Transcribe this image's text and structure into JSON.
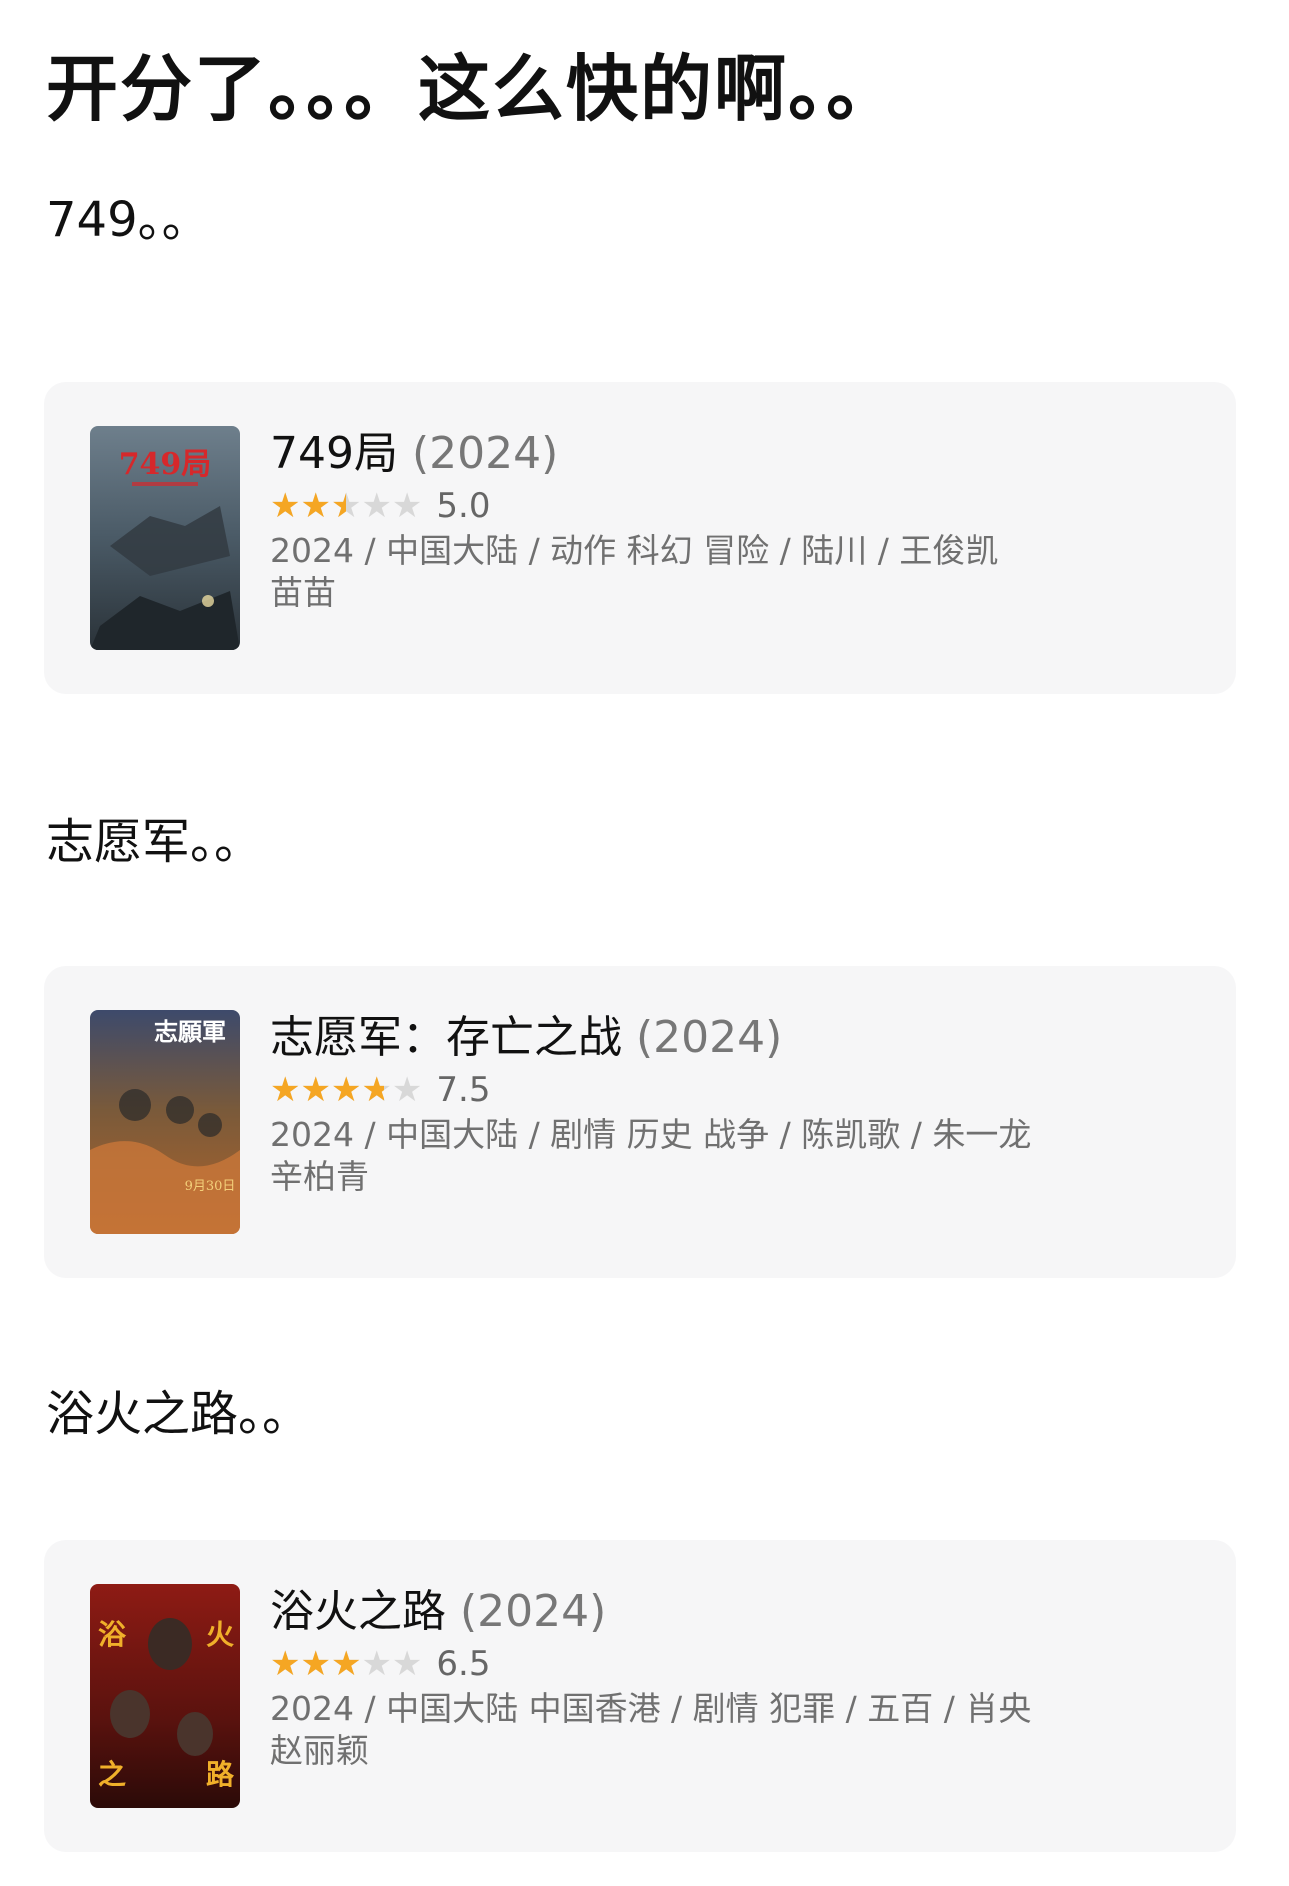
{
  "post": {
    "title": "开分了。。。这么快的啊。。"
  },
  "sections": [
    {
      "caption": "749。。",
      "movie": {
        "name": "749局",
        "year": "(2024)",
        "score": "5.0",
        "rating_fraction": 0.5,
        "meta_line1": "2024 / 中国大陆 / 动作 科幻 冒险 / 陆川 / 王俊凯",
        "meta_line2": "苗苗",
        "poster_text": "749局",
        "poster_icon": "movie-poster-749"
      }
    },
    {
      "caption": "志愿军。。",
      "movie": {
        "name": "志愿军：存亡之战",
        "year": "(2024)",
        "score": "7.5",
        "rating_fraction": 0.75,
        "meta_line1": "2024 / 中国大陆 / 剧情 历史 战争 / 陈凯歌 / 朱一龙",
        "meta_line2": "辛柏青",
        "poster_text": "志願軍",
        "poster_date": "9月30日",
        "poster_icon": "movie-poster-volunteers"
      }
    },
    {
      "caption": "浴火之路。。",
      "movie": {
        "name": "浴火之路",
        "year": "(2024)",
        "score": "6.5",
        "rating_fraction": 0.6,
        "meta_line1": "2024 / 中国大陆 中国香港 / 剧情 犯罪 / 五百 / 肖央",
        "meta_line2": "赵丽颖",
        "poster_text": "浴火之路",
        "poster_icon": "movie-poster-fire-road"
      }
    }
  ],
  "colors": {
    "star_filled": "#f5a623",
    "star_empty": "#d8d8d8",
    "card_bg": "#f6f6f7"
  }
}
